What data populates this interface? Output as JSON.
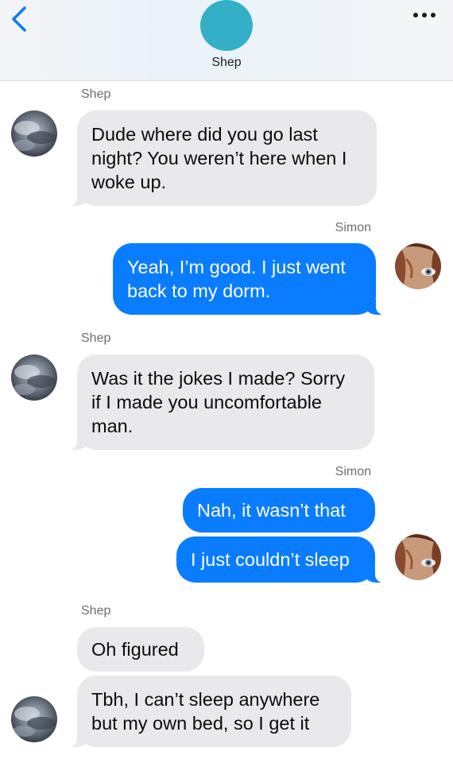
{
  "header": {
    "contact_name": "Shep",
    "avatar_color": "#33b0c8"
  },
  "colors": {
    "incoming_bubble": "#e9e9eb",
    "outgoing_bubble": "#0a7cff",
    "back_arrow": "#0a7cff"
  },
  "messages": {
    "group1": {
      "sender": "Shep",
      "m1": {
        "line1": "Dude where did you go last",
        "line2": "night? You weren’t here when I",
        "line3": "woke up."
      }
    },
    "group2": {
      "sender": "Simon",
      "m1": {
        "line1": "Yeah, I’m good. I just went",
        "line2": "back to my dorm."
      }
    },
    "group3": {
      "sender": "Shep",
      "m1": {
        "line1": "Was it the jokes I made? Sorry",
        "line2": "if I made you uncomfortable",
        "line3": "man."
      }
    },
    "group4": {
      "sender": "Simon",
      "m1": "Nah, it wasn’t that",
      "m2": "I just couldn’t sleep"
    },
    "group5": {
      "sender": "Shep",
      "m1": "Oh figured",
      "m2": {
        "line1": "Tbh, I can’t sleep anywhere",
        "line2": "but my own bed, so I get it"
      }
    }
  },
  "icons": {
    "back": "chevron-left-icon",
    "more": "ellipsis-icon",
    "shep_avatar": "storm-cloud-avatar",
    "simon_avatar": "eye-portrait-avatar"
  }
}
